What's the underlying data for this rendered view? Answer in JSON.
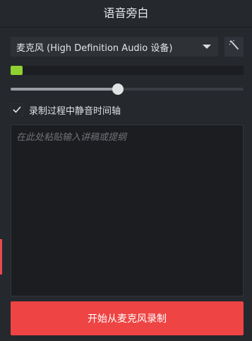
{
  "panel": {
    "title": "语音旁白"
  },
  "device": {
    "selected_label": "麦克风 (High Definition Audio 设备)",
    "icon": "chevron-down-icon"
  },
  "wand_button": {
    "icon": "magic-wand-icon"
  },
  "input_level": {
    "fraction": 0.05,
    "color": "#8fd132"
  },
  "volume_slider": {
    "fraction": 0.46
  },
  "mute_timeline": {
    "checked": true,
    "label": "录制过程中静音时间轴"
  },
  "script": {
    "value": "",
    "placeholder": "在此处粘贴输入讲稿或提纲"
  },
  "record_button": {
    "label": "开始从麦克风录制",
    "color": "#ee4444"
  }
}
